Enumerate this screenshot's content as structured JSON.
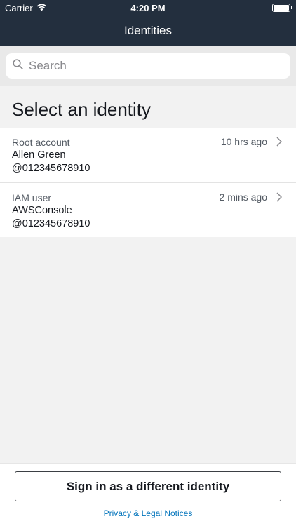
{
  "status_bar": {
    "carrier": "Carrier",
    "time": "4:20 PM"
  },
  "nav": {
    "title": "Identities"
  },
  "search": {
    "placeholder": "Search"
  },
  "section": {
    "title": "Select an identity"
  },
  "identities": [
    {
      "type": "Root account",
      "name": "Allen Green",
      "account": "@012345678910",
      "last_used": "10 hrs ago"
    },
    {
      "type": "IAM user",
      "name": "AWSConsole",
      "account": "@012345678910",
      "last_used": "2 mins ago"
    }
  ],
  "footer": {
    "signin_label": "Sign in as a different identity",
    "privacy_label": "Privacy & Legal Notices"
  },
  "colors": {
    "header_bg": "#232f3e",
    "link": "#0073bb",
    "background": "#f2f2f2"
  },
  "icons": [
    "wifi-icon",
    "battery-icon",
    "search-icon",
    "chevron-right-icon"
  ]
}
